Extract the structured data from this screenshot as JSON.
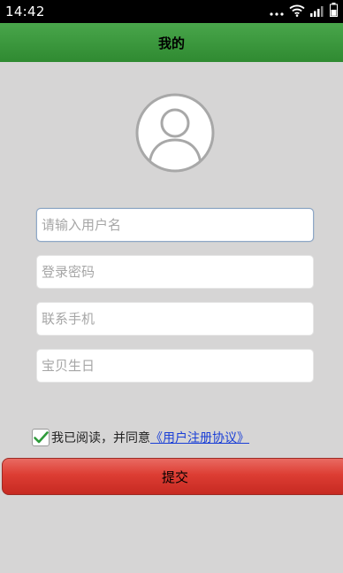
{
  "status_bar": {
    "time": "14:42",
    "icons": [
      "dots-icon",
      "wifi-icon",
      "signal-icon",
      "battery-icon"
    ]
  },
  "header": {
    "title": "我的"
  },
  "profile": {
    "avatar_icon": "user-avatar-icon"
  },
  "form": {
    "username": {
      "value": "",
      "placeholder": "请输入用户名"
    },
    "password": {
      "value": "",
      "placeholder": "登录密码"
    },
    "phone": {
      "value": "",
      "placeholder": "联系手机"
    },
    "birthday": {
      "value": "",
      "placeholder": "宝贝生日"
    }
  },
  "agreement": {
    "checked": true,
    "text": "我已阅读，并同意",
    "link_text": "《用户注册协议》"
  },
  "submit": {
    "label": "提交"
  },
  "colors": {
    "header": "#3a9a3c",
    "background": "#d6d5d5",
    "submit": "#dd3d33",
    "link": "#1a3fd6",
    "check": "#2e9a3a"
  }
}
